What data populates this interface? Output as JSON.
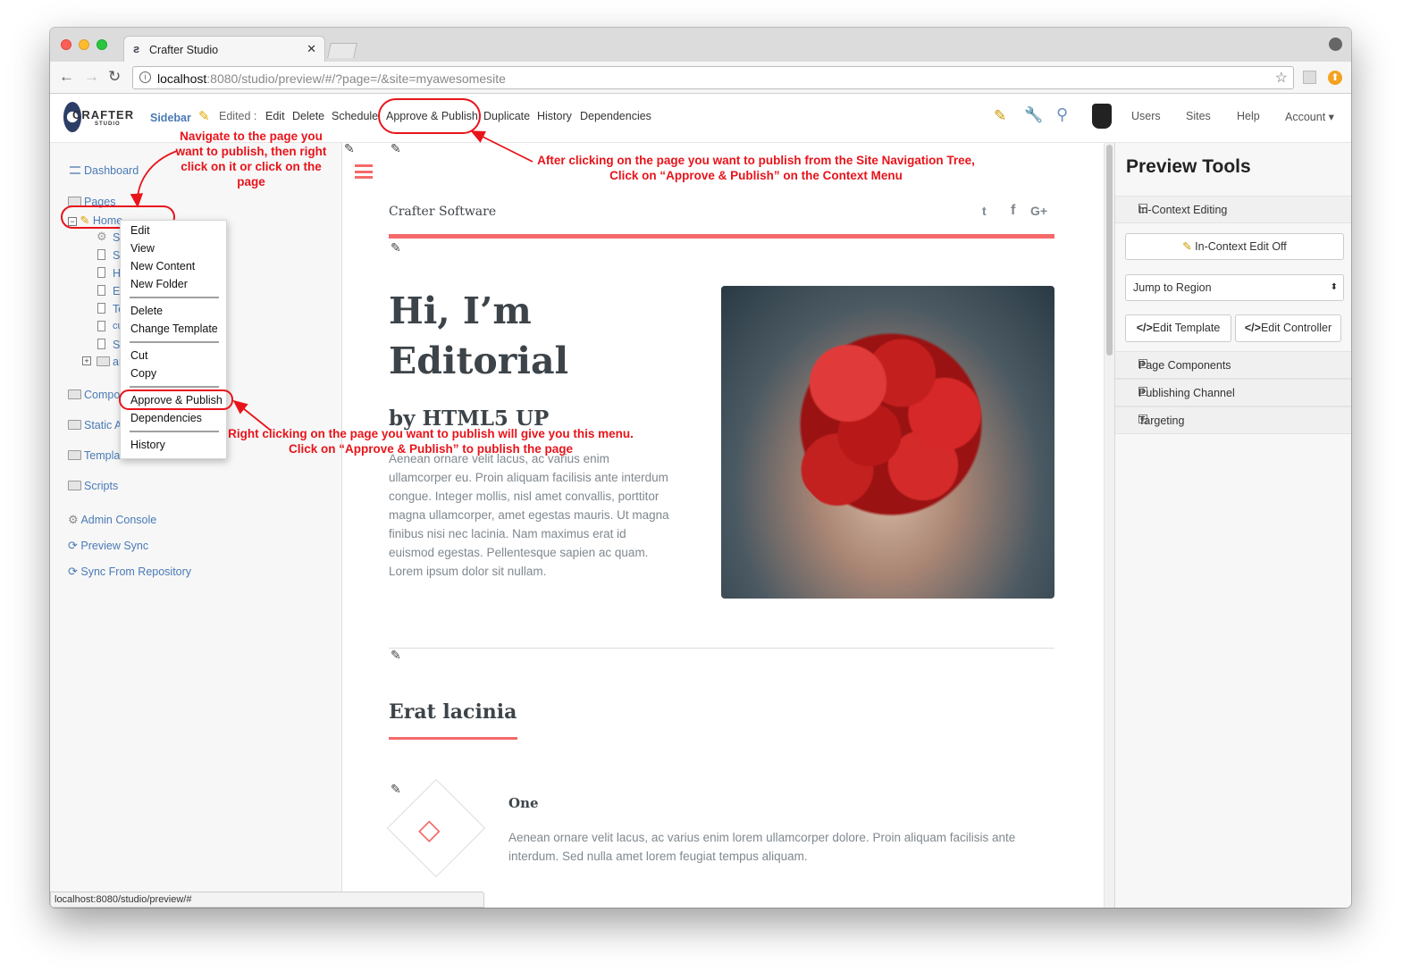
{
  "browser": {
    "tab_title": "Crafter Studio",
    "url_host": "localhost",
    "url_rest": ":8080/studio/preview/#/?page=/&site=myawesomesite",
    "status_url": "localhost:8080/studio/preview/#"
  },
  "studio": {
    "logo_text": "CRAFTER",
    "logo_sub": "STUDIO",
    "sidebar_label": "Sidebar",
    "edited_label": "Edited :",
    "actions": [
      "Edit",
      "Delete",
      "Schedule",
      "Approve & Publish",
      "Duplicate",
      "History",
      "Dependencies"
    ],
    "nav": [
      "Users",
      "Sites",
      "Help",
      "Account"
    ]
  },
  "sidebar": {
    "dashboard": "Dashboard",
    "pages": "Pages",
    "home": "Home",
    "tree_children": [
      "S",
      "S",
      "H",
      "E",
      "Te",
      "cu",
      "S",
      "ar"
    ],
    "components": "Compo",
    "static_assets": "Static A",
    "templates": "Templates",
    "scripts": "Scripts",
    "admin_console": "Admin Console",
    "preview_sync": "Preview Sync",
    "sync_repo": "Sync From Repository"
  },
  "context_menu": {
    "edit": "Edit",
    "view": "View",
    "new_content": "New Content",
    "new_folder": "New Folder",
    "delete": "Delete",
    "change_template": "Change Template",
    "cut": "Cut",
    "copy": "Copy",
    "approve_publish": "Approve & Publish",
    "dependencies": "Dependencies",
    "history": "History"
  },
  "annotations": {
    "navigate": "Navigate to the page you want to publish, then right click on it or click on the page",
    "after_click": "After clicking on the page you want to publish from the Site Navigation Tree,",
    "after_click2": "Click on “Approve & Publish” on the Context Menu",
    "right_click": "Right clicking on the page you want to publish will give you this menu.",
    "right_click2": "Click on “Approve & Publish” to publish the page"
  },
  "preview": {
    "site_name": "Crafter Software",
    "social": [
      "twitter-icon",
      "facebook-icon",
      "google-plus-icon"
    ],
    "hero_title_1": "Hi, I’m",
    "hero_title_2": "Editorial",
    "hero_subtitle": "by HTML5 UP",
    "hero_body": "Aenean ornare velit lacus, ac varius enim ullamcorper eu. Proin aliquam facilisis ante interdum congue. Integer mollis, nisl amet convallis, porttitor magna ullamcorper, amet egestas mauris. Ut magna finibus nisi nec lacinia. Nam maximus erat id euismod egestas. Pellentesque sapien ac quam. Lorem ipsum dolor sit nullam.",
    "section_title": "Erat lacinia",
    "feature_title": "One",
    "feature_body": "Aenean ornare velit lacus, ac varius enim lorem ullamcorper dolore. Proin aliquam facilisis ante interdum. Sed nulla amet lorem feugiat tempus aliquam.",
    "accent": "#f56a6a"
  },
  "tools": {
    "title": "Preview Tools",
    "in_context_editing": "In-Context Editing",
    "edit_toggle": "In-Context Edit Off",
    "jump_to_region": "Jump to Region",
    "edit_template": "Edit Template",
    "edit_controller": "Edit Controller",
    "page_components": "Page Components",
    "publishing_channel": "Publishing Channel",
    "targeting": "Targeting"
  }
}
